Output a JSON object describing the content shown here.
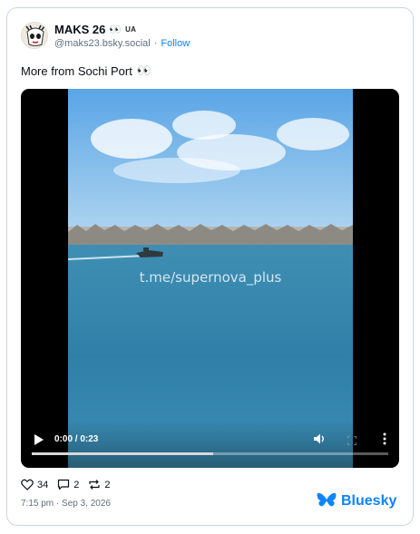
{
  "author": {
    "display_name": "MAKS 26",
    "name_emoji": "👀",
    "flag_label": "UA",
    "handle": "@maks23.bsky.social",
    "separator": "·",
    "follow_label": "Follow"
  },
  "post": {
    "text": "More from Sochi Port",
    "text_emoji": "👀"
  },
  "video": {
    "watermark": "t.me/supernova_plus",
    "time_display": "0:00 / 0:23",
    "progress_fraction": 0.51
  },
  "stats": {
    "likes": "34",
    "replies": "2",
    "reposts": "2"
  },
  "timestamp": "7:15 pm · Sep 3, 2026",
  "brand": "Bluesky",
  "colors": {
    "accent": "#1083fe",
    "muted": "#5f6f80",
    "border": "#c9d6e3"
  }
}
